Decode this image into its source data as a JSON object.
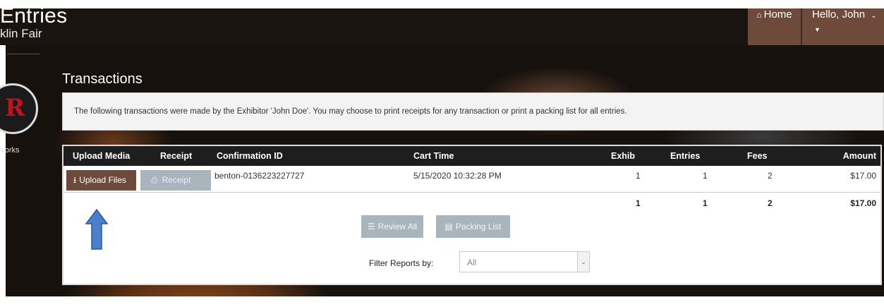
{
  "header": {
    "app_title": "Entries",
    "app_subtitle": "klin Fair",
    "home_label": "Home",
    "user_label": "Hello, John"
  },
  "sidebar": {
    "text": "Vorks",
    "logo_letter": "R"
  },
  "page": {
    "title": "Transactions",
    "info": "The following transactions were made by the Exhibitor 'John Doe'. You may choose to print receipts for any transaction or print a packing list for all entries."
  },
  "table": {
    "columns": [
      "Upload Media",
      "Receipt",
      "Confirmation ID",
      "Cart Time",
      "Exhib",
      "Entries",
      "Fees",
      "Amount"
    ],
    "rows": [
      {
        "upload_label": "Upload Files",
        "receipt_label": "Receipt",
        "confirmation_id": "benton-0136223227727",
        "cart_time": "5/15/2020 10:32:28 PM",
        "exhib": "1",
        "entries": "1",
        "fees": "2",
        "amount": "$17.00"
      }
    ],
    "totals": {
      "exhib": "1",
      "entries": "1",
      "fees": "2",
      "amount": "$17.00"
    }
  },
  "actions": {
    "review_all": "Review All",
    "packing_list": "Packing List"
  },
  "filter": {
    "label": "Filter Reports by:",
    "selected": "All"
  },
  "icons": [
    "home-icon",
    "upload-icon",
    "print-icon",
    "list-icon",
    "packing-icon",
    "chevron-down-icon",
    "caret-down-icon",
    "arrow-up-icon"
  ],
  "colors": {
    "accent": "#6e4a3a",
    "disabled_button": "#a9b5bd",
    "arrow": "#4a7fcb"
  }
}
